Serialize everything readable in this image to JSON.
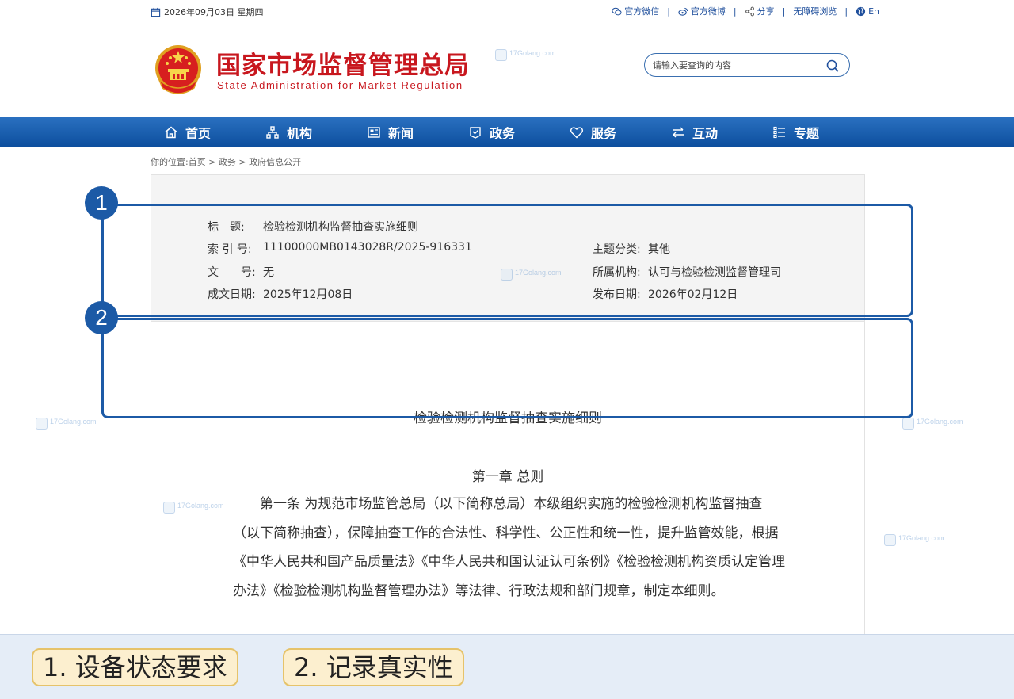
{
  "topbar": {
    "date": "2026年09月03日 星期四",
    "links": [
      {
        "label": "官方微信",
        "icon": "wechat-icon"
      },
      {
        "label": "官方微博",
        "icon": "weibo-icon"
      },
      {
        "label": "分享",
        "icon": "share-icon"
      },
      {
        "label": "无障碍浏览",
        "icon": ""
      },
      {
        "label": "En",
        "icon": "globe-icon"
      }
    ],
    "separator": "|"
  },
  "header": {
    "title_cn": "国家市场监督管理总局",
    "title_en": "State Administration for Market Regulation",
    "search_placeholder": "请输入要查询的内容"
  },
  "nav": {
    "items": [
      {
        "label": "首页",
        "icon": "home-icon"
      },
      {
        "label": "机构",
        "icon": "org-chart-icon"
      },
      {
        "label": "新闻",
        "icon": "newspaper-icon"
      },
      {
        "label": "政务",
        "icon": "document-shield-icon"
      },
      {
        "label": "服务",
        "icon": "heart-icon"
      },
      {
        "label": "互动",
        "icon": "swap-icon"
      },
      {
        "label": "专题",
        "icon": "list-icon"
      }
    ]
  },
  "breadcrumb": "你的位置:首页 > 政务 > 政府信息公开",
  "meta": {
    "title_label": "标　题:",
    "title_value": "检验检测机构监督抽查实施细则",
    "index_label": "索 引 号:",
    "index_value": "11100000MB0143028R/2025-916331",
    "docno_label": "文　　号:",
    "docno_value": "无",
    "date_label": "成文日期:",
    "date_value": "2025年12月08日",
    "category_label": "主题分类:",
    "category_value": "其他",
    "org_label": "所属机构:",
    "org_value": "认可与检验检测监督管理司",
    "publish_label": "发布日期:",
    "publish_value": "2026年02月12日"
  },
  "document": {
    "title": "检验检测机构监督抽查实施细则",
    "chapter": "第一章 总则",
    "article": "第一条 为规范市场监管总局（以下简称总局）本级组织实施的检验检测机构监督抽查（以下简称抽查），保障抽查工作的合法性、科学性、公正性和统一性，提升监管效能，根据《中华人民共和国产品质量法》《中华人民共和国认证认可条例》《检验检测机构资质认定管理办法》《检验检测机构监督管理办法》等法律、行政法规和部门规章，制定本细则。"
  },
  "annotations": {
    "badge1": "1",
    "badge2": "2"
  },
  "banner": {
    "chip1": "1. 设备状态要求",
    "chip2": "2. 记录真实性"
  },
  "watermark": {
    "text": "17Golang.com"
  },
  "colors": {
    "brand_red": "#c8171e",
    "nav_blue": "#0d4f9e",
    "annotation_blue": "#1c5aa6",
    "chip_fill": "#fcefcf"
  }
}
